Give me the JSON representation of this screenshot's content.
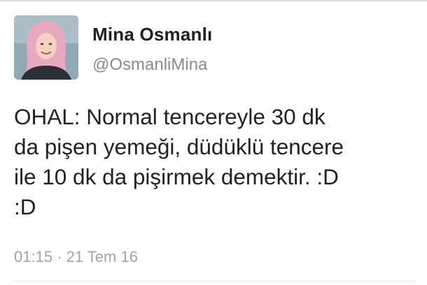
{
  "tweet": {
    "author": {
      "name": "Mina Osmanlı",
      "handle": "@OsmanliMina",
      "avatar_icon": "user-avatar-photo"
    },
    "text_lines": [
      "OHAL: Normal tencereyle 30 dk",
      "da pişen yemeği, düdüklü tencere",
      "ile 10 dk da pişirmek demektir. :D",
      ":D"
    ],
    "timestamp": "01:15 · 21 Tem 16"
  },
  "colors": {
    "name": "#222222",
    "handle": "#8a8a8a",
    "timestamp": "#a3a3a3",
    "divider": "#e3e3e3"
  }
}
